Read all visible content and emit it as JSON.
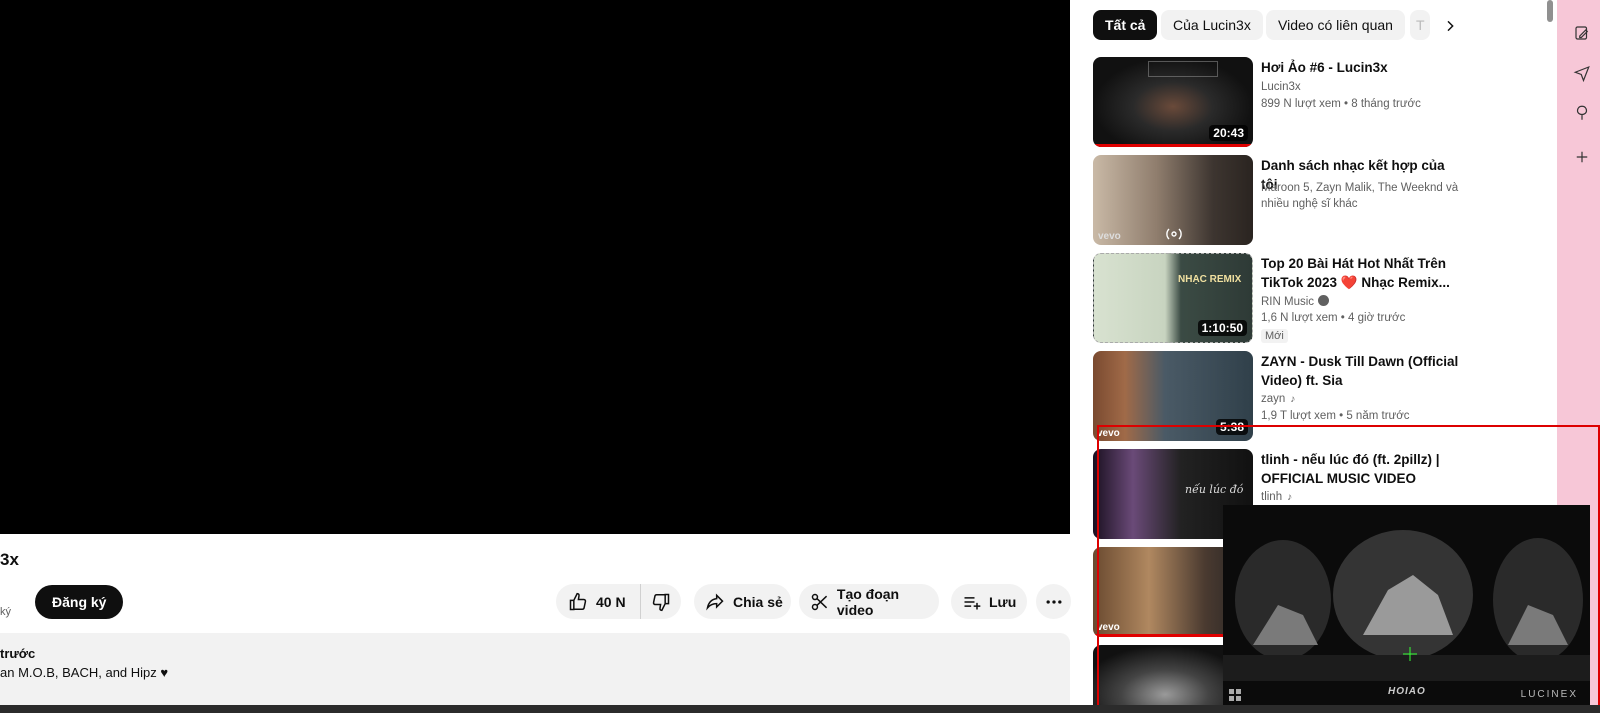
{
  "video": {
    "title_fragment": "3x",
    "subscribers_fragment": "ký",
    "subscribe_label": "Đăng ký",
    "actions": {
      "like_count": "40 N",
      "share_label": "Chia sẻ",
      "clip_label": "Tạo đoạn video",
      "save_label": "Lưu"
    },
    "description": {
      "line1": "trước",
      "line2": "an M.O.B, BACH, and Hipz ♥"
    }
  },
  "chips": {
    "all": "Tất cả",
    "channel": "Của Lucin3x",
    "related": "Video có liên quan",
    "partial": "T"
  },
  "recommendations": [
    {
      "title": "Hơi Ảo #6 - Lucin3x",
      "channel": "Lucin3x",
      "views": "899 N lượt xem",
      "age": "8 tháng trước",
      "duration": "20:43"
    },
    {
      "title": "Danh sách nhạc kết hợp của tôi",
      "channel": "Maroon 5, Zayn Malik, The Weeknd và nhiều nghệ sĩ khác",
      "thumb_mark": "vevo"
    },
    {
      "title": "Top 20 Bài Hát Hot Nhất Trên TikTok 2023 ❤️ Nhạc Remix...",
      "channel": "RIN Music",
      "views": "1,6 N lượt xem",
      "age": "4 giờ trước",
      "badge": "Mới",
      "duration": "1:10:50",
      "thumb_text": "NHẠC REMIX"
    },
    {
      "title": "ZAYN - Dusk Till Dawn (Official Video) ft. Sia",
      "channel": "zayn",
      "views": "1,9 T lượt xem",
      "age": "5 năm trước",
      "duration": "5:38",
      "thumb_mark": "vevo"
    },
    {
      "title": "tlinh - nếu lúc đó (ft. 2pillz) | OFFICIAL MUSIC VIDEO",
      "channel": "tlinh",
      "thumb_text": "nếu lúc đó"
    },
    {
      "thumb_mark": "vevo"
    }
  ],
  "miniplayer": {
    "logo": "HOIAO",
    "brand": "LUCINEX"
  },
  "colors": {
    "accent_red": "#e00000",
    "sidebar_pink": "#f7c7d7",
    "selection_red": "#dd0000"
  },
  "icons": [
    "like-icon",
    "dislike-icon",
    "share-icon",
    "scissors-icon",
    "playlist-add-icon",
    "more-icon",
    "chevron-right-icon",
    "edit-icon",
    "send-icon",
    "tree-icon",
    "plus-icon"
  ]
}
